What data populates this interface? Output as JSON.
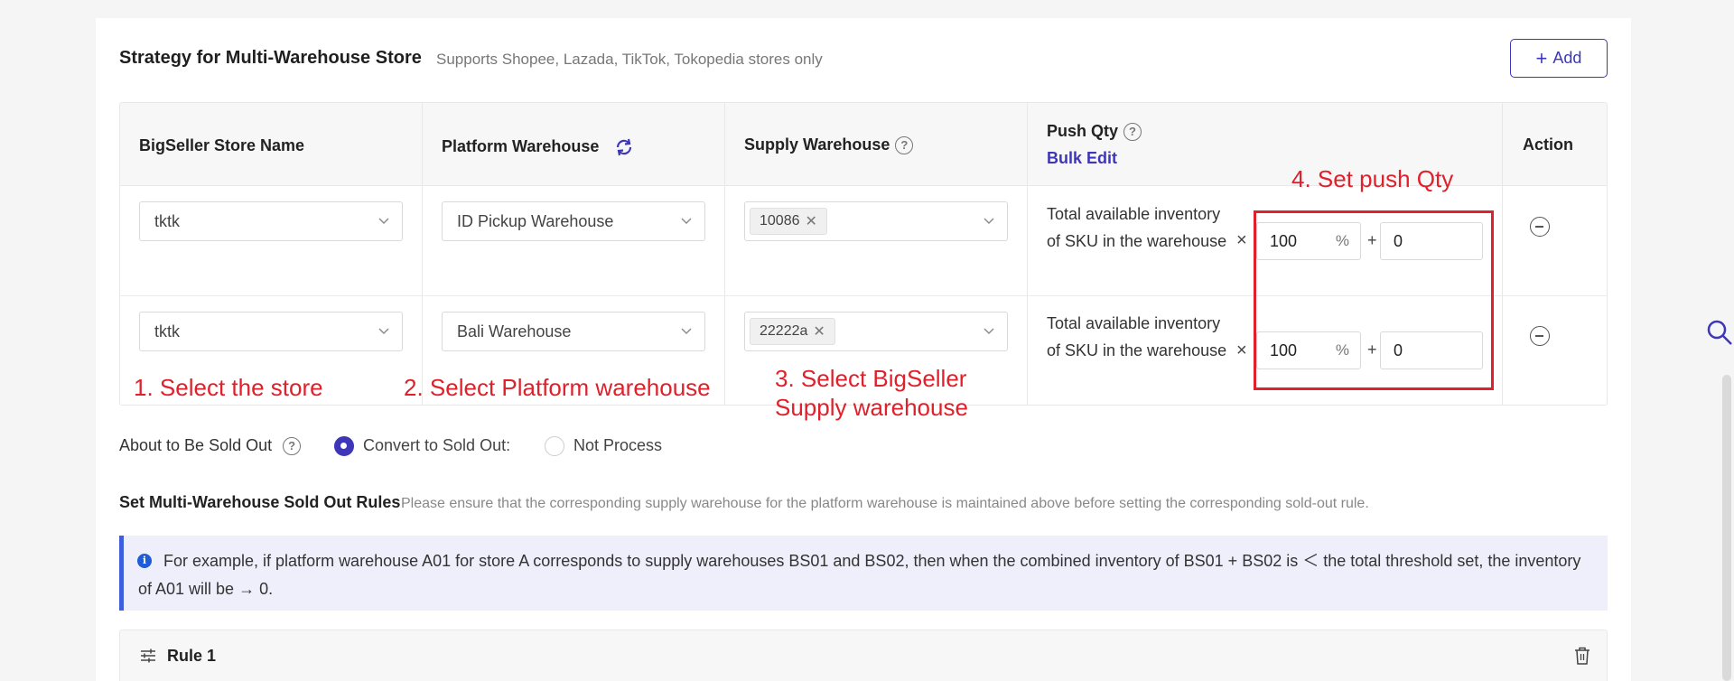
{
  "header": {
    "title": "Strategy for Multi-Warehouse Store",
    "subtitle": "Supports Shopee, Lazada, TikTok, Tokopedia stores only",
    "add_label": "Add"
  },
  "table": {
    "columns": {
      "store": "BigSeller Store Name",
      "platform": "Platform Warehouse",
      "supply": "Supply Warehouse",
      "push": "Push Qty",
      "bulk_edit": "Bulk Edit",
      "action": "Action"
    },
    "rows": [
      {
        "store": "tktk",
        "platform_warehouse": "ID Pickup Warehouse",
        "supply_tag": "10086",
        "inventory_text": "Total available inventory of SKU in the warehouse",
        "percent": "100",
        "percent_unit": "%",
        "offset": "0"
      },
      {
        "store": "tktk",
        "platform_warehouse": "Bali Warehouse",
        "supply_tag": "22222a",
        "inventory_text": "Total available inventory of SKU in the warehouse",
        "percent": "100",
        "percent_unit": "%",
        "offset": "0"
      }
    ],
    "times_symbol": "×",
    "plus_symbol": "+"
  },
  "annotations": {
    "step1": "1. Select the store",
    "step2": "2. Select Platform warehouse",
    "step3_line1": "3. Select BigSeller",
    "step3_line2": "Supply warehouse",
    "step4": "4. Set push Qty"
  },
  "sold_out": {
    "label": "About to Be Sold Out",
    "option_convert": "Convert to Sold Out:",
    "option_not_process": "Not Process",
    "selected": "convert"
  },
  "rules": {
    "title": "Set Multi-Warehouse Sold Out Rules",
    "description": "Please ensure that the corresponding supply warehouse for the platform warehouse is maintained above before setting the corresponding sold-out rule.",
    "info_text": "For example, if platform warehouse A01 for store A corresponds to supply warehouses BS01 and BS02, then when the combined inventory of BS01 + BS02 is ＜ the total threshold set, the inventory of A01 will be → 0.",
    "rule_title": "Rule 1"
  },
  "colors": {
    "accent": "#3d36b8",
    "annotation": "#e0202a",
    "info_bg": "#efeefb"
  }
}
